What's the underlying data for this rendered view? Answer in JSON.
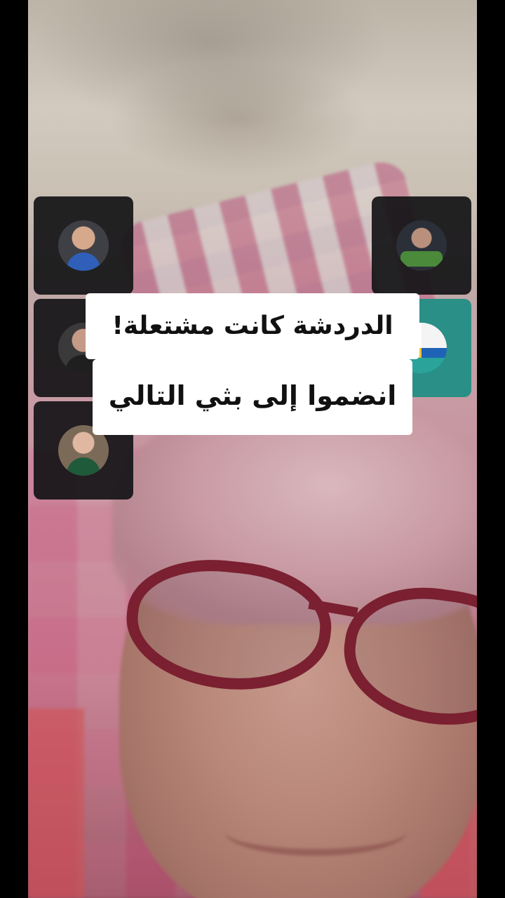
{
  "banner": {
    "line_1": "الدردشة كانت مشتعلة!",
    "line_2": "انضموا إلى بثي التالي"
  },
  "guests": [
    {
      "position": "left-top",
      "avatar": "avatar-man-blue-shirt"
    },
    {
      "position": "left-middle",
      "avatar": "avatar-man-dark-shirt"
    },
    {
      "position": "left-bottom",
      "avatar": "avatar-woman-desk"
    },
    {
      "position": "right-top",
      "avatar": "avatar-man-driving"
    },
    {
      "position": "right-middle",
      "avatar": "avatar-logo-teal"
    }
  ],
  "colors": {
    "banner_background": "#ffffff",
    "banner_text": "#111111",
    "tile_background": "#141416",
    "tile_teal": "#2a8f86"
  }
}
